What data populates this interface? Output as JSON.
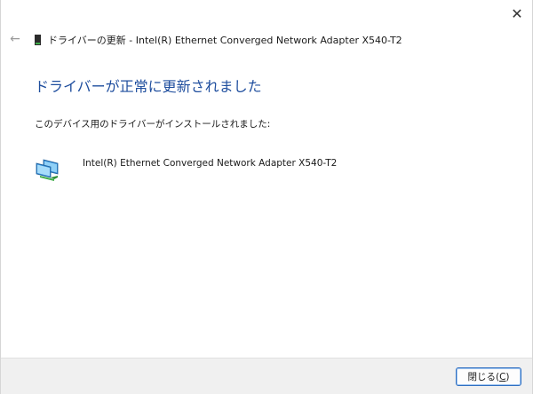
{
  "window": {
    "close_glyph": "✕"
  },
  "nav": {
    "back_glyph": "←"
  },
  "header": {
    "title": "ドライバーの更新 - Intel(R) Ethernet Converged Network Adapter X540-T2",
    "title_icon": "device-card-icon"
  },
  "main": {
    "heading": "ドライバーが正常に更新されました",
    "subtext": "このデバイス用のドライバーがインストールされました:",
    "device_icon": "network-adapter-icon",
    "device_name": "Intel(R) Ethernet Converged Network Adapter X540-T2"
  },
  "footer": {
    "close_label_prefix": "閉じる(",
    "close_accel": "C",
    "close_label_suffix": ")"
  },
  "colors": {
    "heading": "#1f4e9e",
    "button_border": "#2f6fc1",
    "footer_bg": "#f0f0f0"
  }
}
